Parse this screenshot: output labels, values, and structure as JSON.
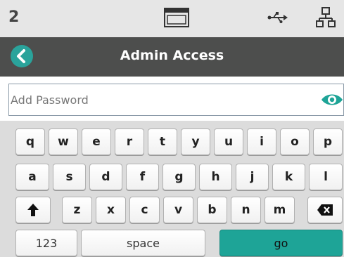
{
  "status_bar": {
    "indicator": "2",
    "icons": [
      "display-icon",
      "usb-icon",
      "network-icon"
    ]
  },
  "header": {
    "title": "Admin Access",
    "back_icon": "chevron-left-icon"
  },
  "password_field": {
    "placeholder": "Add Password",
    "value": "",
    "visibility_icon": "eye-icon"
  },
  "keyboard": {
    "row1": [
      "q",
      "w",
      "e",
      "r",
      "t",
      "y",
      "u",
      "i",
      "o",
      "p"
    ],
    "row2": [
      "a",
      "s",
      "d",
      "f",
      "g",
      "h",
      "j",
      "k",
      "l"
    ],
    "row3": [
      "z",
      "x",
      "c",
      "v",
      "b",
      "n",
      "m"
    ],
    "shift_icon": "shift-arrow-icon",
    "backspace_icon": "backspace-icon",
    "numbers_label": "123",
    "space_label": "space",
    "go_label": "go"
  },
  "colors": {
    "accent": "#1ea497",
    "header_bg": "#4d4e4d",
    "status_bg": "#e6e6e6",
    "keyboard_bg": "#dcdcdc"
  }
}
